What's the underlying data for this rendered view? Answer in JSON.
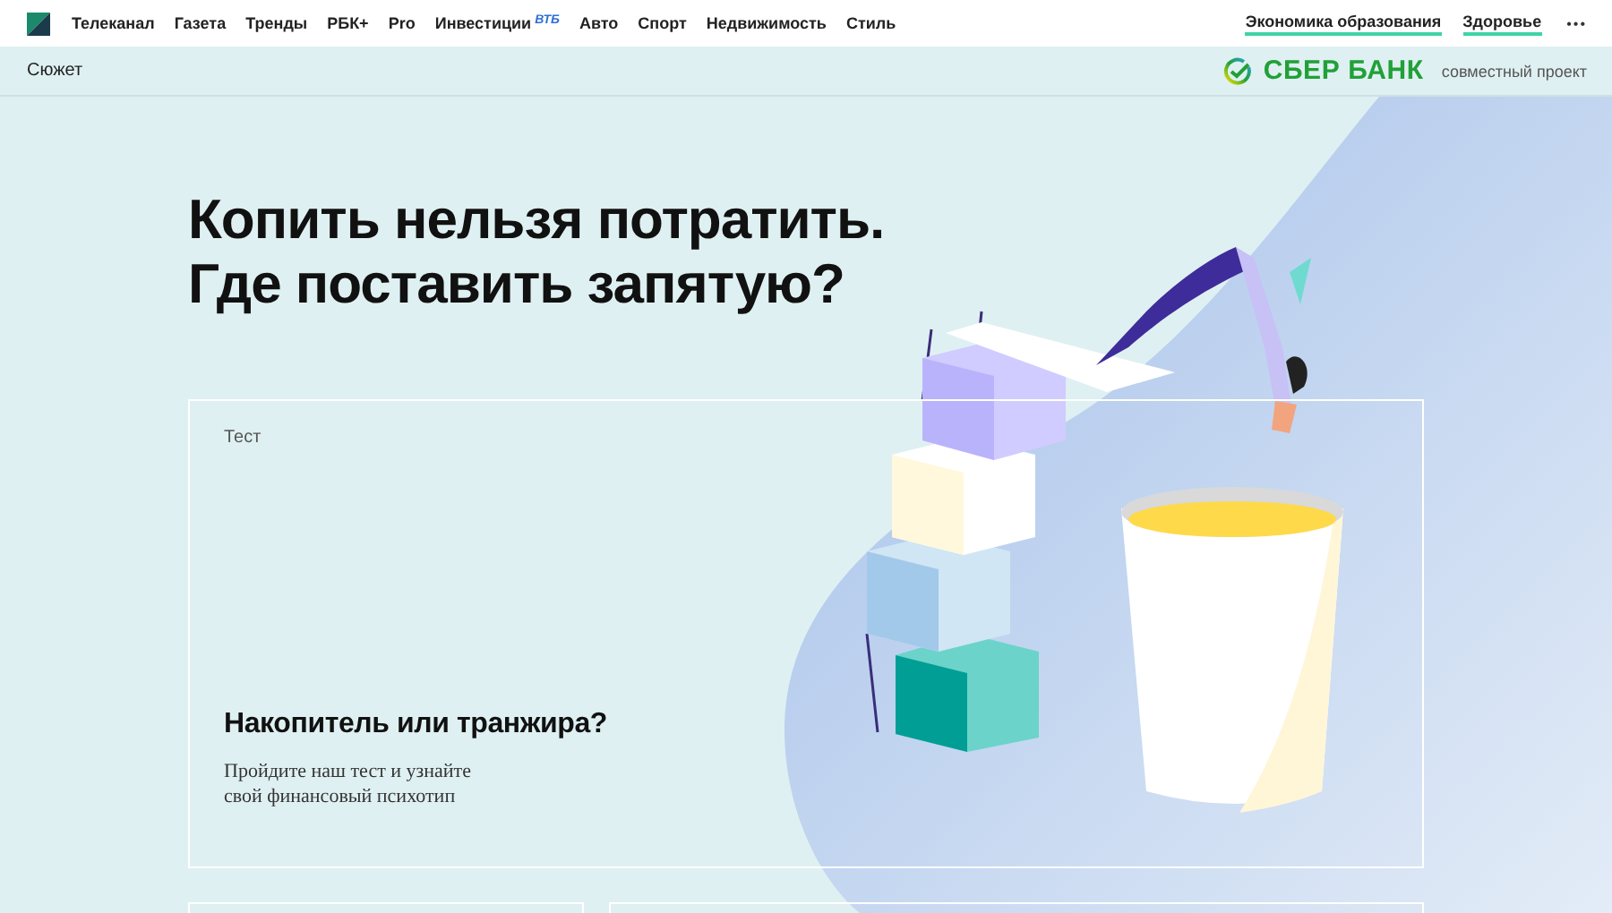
{
  "top_nav": {
    "items": [
      {
        "label": "Телеканал"
      },
      {
        "label": "Газета"
      },
      {
        "label": "Тренды"
      },
      {
        "label": "РБК+"
      },
      {
        "label": "Pro"
      },
      {
        "label": "Инвестиции",
        "partner": "ВТБ"
      },
      {
        "label": "Авто"
      },
      {
        "label": "Спорт"
      },
      {
        "label": "Недвижимость"
      },
      {
        "label": "Стиль"
      }
    ],
    "special_links": [
      "Экономика образования",
      "Здоровье"
    ],
    "more": "•••"
  },
  "subbar": {
    "section": "Сюжет",
    "sponsor": "СБЕР БАНК",
    "sponsor_note": "совместный проект"
  },
  "headline": [
    "Копить нельзя потратить.",
    "Где поставить запятую?"
  ],
  "feature_card": {
    "tag": "Тест",
    "title": "Накопитель или транжира?",
    "description": [
      "Пройдите наш тест и узнайте",
      "свой финансовый психотип"
    ]
  }
}
